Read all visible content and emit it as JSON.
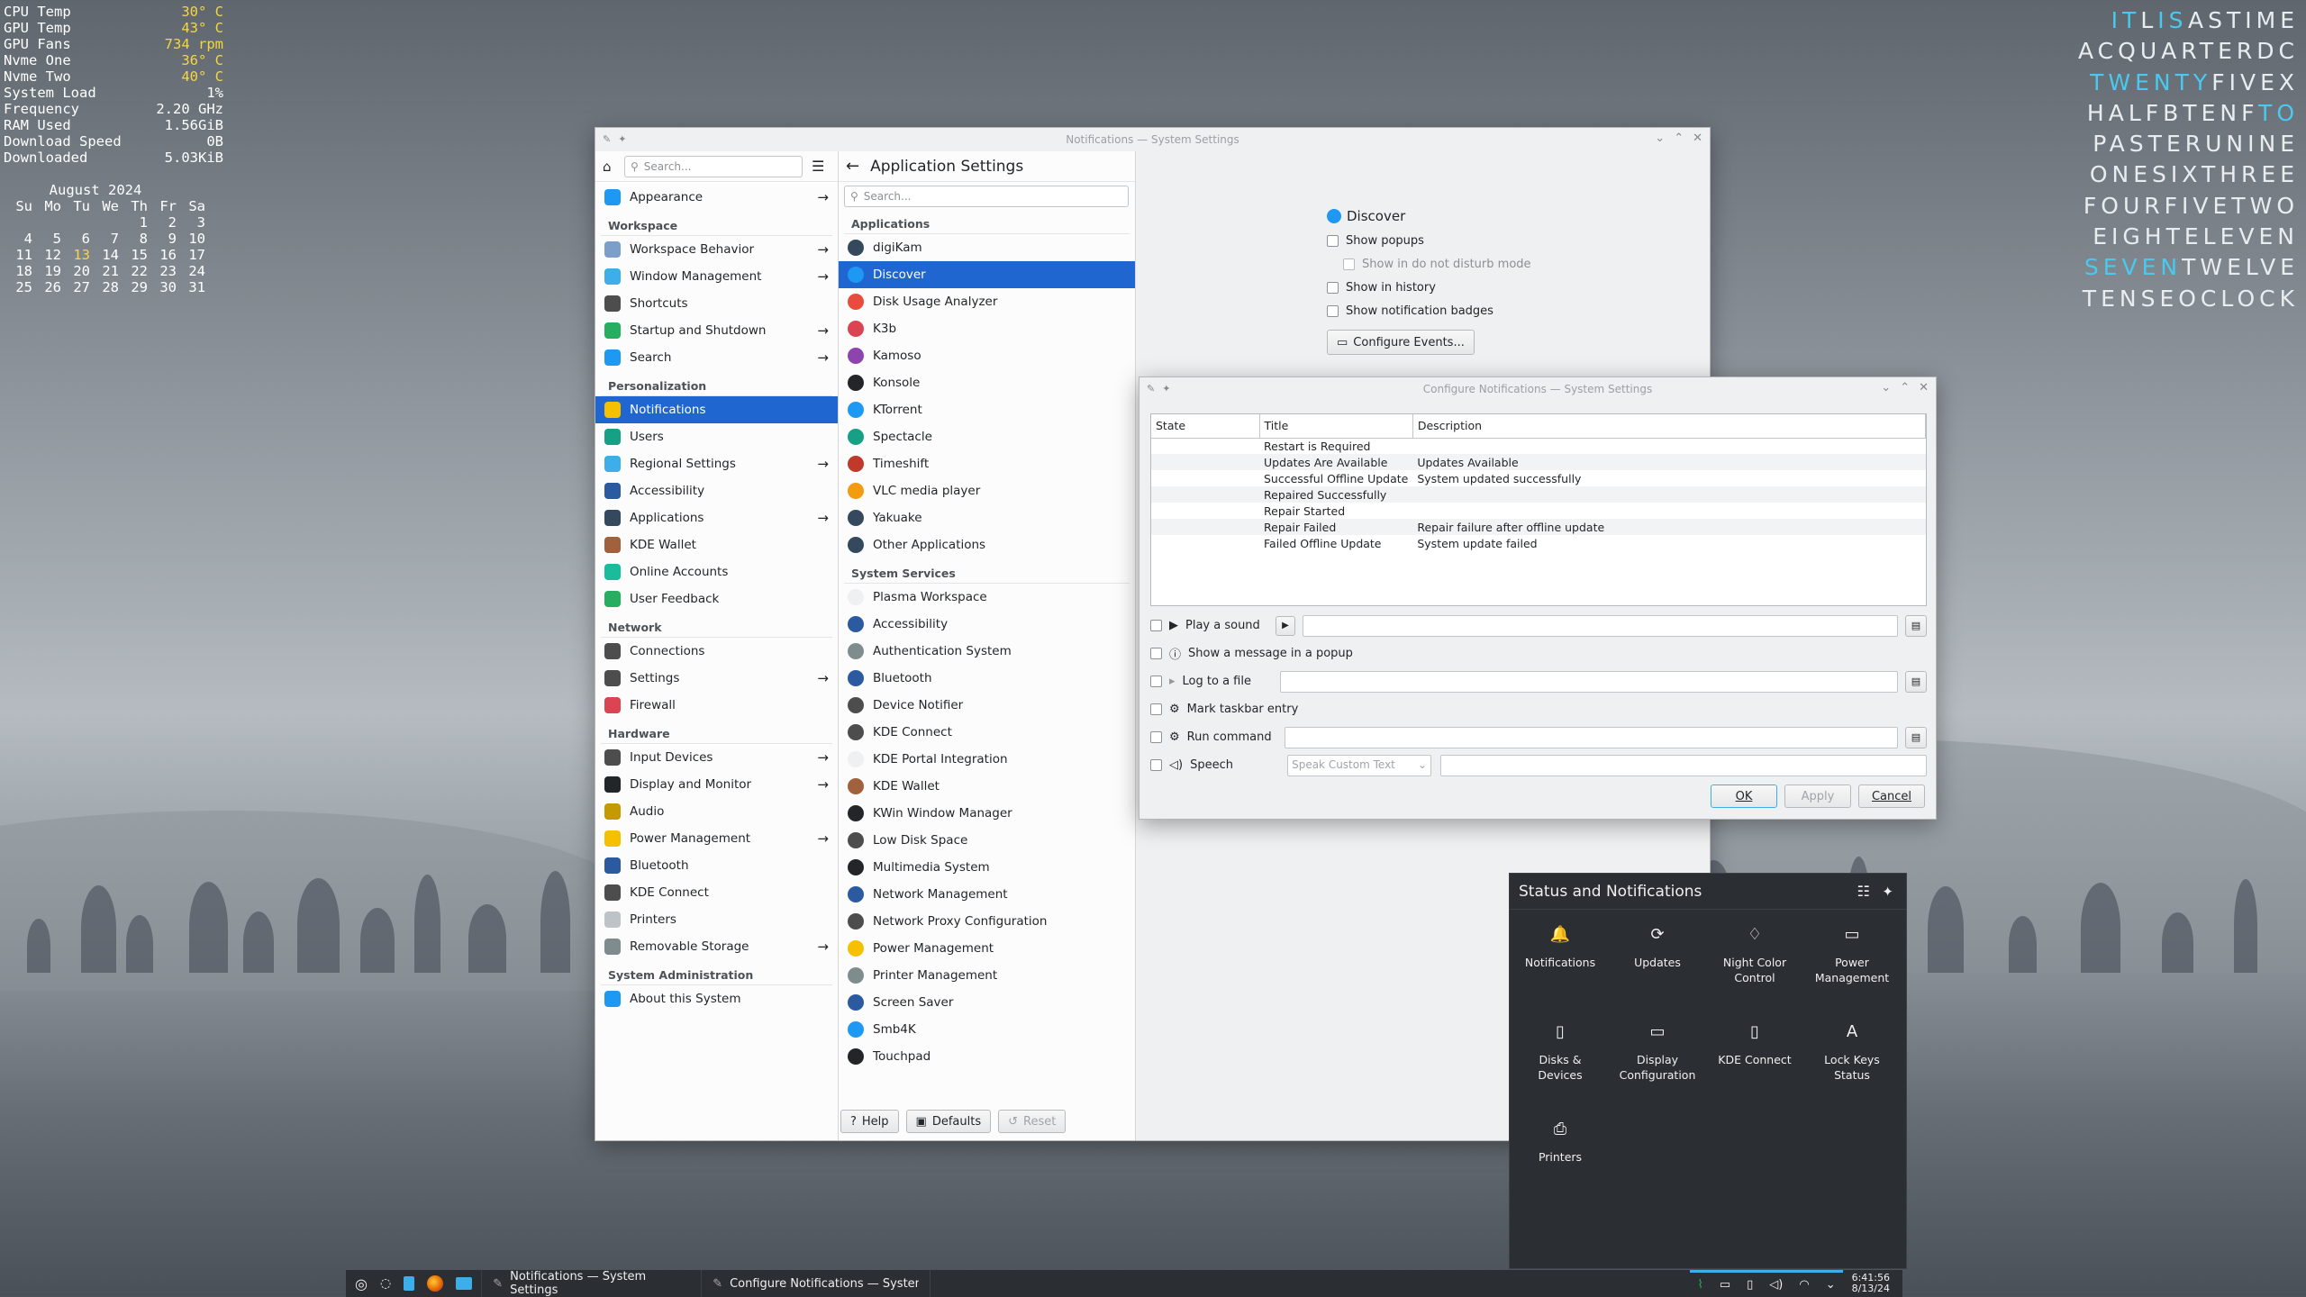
{
  "conky": {
    "rows": [
      [
        "CPU Temp",
        "30° C"
      ],
      [
        "GPU Temp",
        "43° C"
      ],
      [
        "GPU Fans",
        "734 rpm"
      ],
      [
        "Nvme One",
        "36° C"
      ],
      [
        "Nvme Two",
        "40° C"
      ],
      [
        "System Load",
        "1%"
      ],
      [
        "Frequency",
        "2.20 GHz"
      ],
      [
        "RAM Used",
        "1.56GiB"
      ],
      [
        "Download Speed",
        "0B"
      ],
      [
        "Downloaded",
        "5.03KiB"
      ]
    ],
    "calendar_title": "August 2024",
    "calendar_header": [
      "Su",
      "Mo",
      "Tu",
      "We",
      "Th",
      "Fr",
      "Sa"
    ],
    "calendar_days": [
      "",
      "",
      "",
      "",
      "1",
      "2",
      "3",
      "4",
      "5",
      "6",
      "7",
      "8",
      "9",
      "10",
      "11",
      "12",
      "13",
      "14",
      "15",
      "16",
      "17",
      "18",
      "19",
      "20",
      "21",
      "22",
      "23",
      "24",
      "25",
      "26",
      "27",
      "28",
      "29",
      "30",
      "31"
    ],
    "today": "13",
    "accent": "#f5d742"
  },
  "word_clock": {
    "lines": [
      "ITLISASTIME",
      "ACQUARTERDC",
      "TWENTYFIVEX",
      "HALFBTENFTO",
      "PASTERUNINE",
      "ONESIXTHREE",
      "FOURFIVETWO",
      "EIGHTELEVEN",
      "SEVENTWELVE",
      "TENSEOCLOCK"
    ],
    "highlight_color": "#49c9ef"
  },
  "settings": {
    "window_title": "Notifications — System Settings",
    "search_placeholder": "Search...",
    "page_title": "Application Settings",
    "sidebar": [
      {
        "type": "item",
        "label": "Appearance",
        "arrow": true,
        "color": "#1d99f3"
      },
      {
        "type": "head",
        "label": "Workspace"
      },
      {
        "type": "item",
        "label": "Workspace Behavior",
        "arrow": true,
        "color": "#7b9fc9"
      },
      {
        "type": "item",
        "label": "Window Management",
        "arrow": true,
        "color": "#3daee9"
      },
      {
        "type": "item",
        "label": "Shortcuts",
        "arrow": false,
        "color": "#4d4d4d"
      },
      {
        "type": "item",
        "label": "Startup and Shutdown",
        "arrow": true,
        "color": "#27ae60"
      },
      {
        "type": "item",
        "label": "Search",
        "arrow": true,
        "color": "#1d99f3"
      },
      {
        "type": "head",
        "label": "Personalization"
      },
      {
        "type": "item",
        "label": "Notifications",
        "arrow": false,
        "color": "#f6c000",
        "selected": true
      },
      {
        "type": "item",
        "label": "Users",
        "arrow": false,
        "color": "#16a085"
      },
      {
        "type": "item",
        "label": "Regional Settings",
        "arrow": true,
        "color": "#3daee9"
      },
      {
        "type": "item",
        "label": "Accessibility",
        "arrow": false,
        "color": "#2c5aa0"
      },
      {
        "type": "item",
        "label": "Applications",
        "arrow": true,
        "color": "#34495e"
      },
      {
        "type": "item",
        "label": "KDE Wallet",
        "arrow": false,
        "color": "#a0613c"
      },
      {
        "type": "item",
        "label": "Online Accounts",
        "arrow": false,
        "color": "#1abc9c"
      },
      {
        "type": "item",
        "label": "User Feedback",
        "arrow": false,
        "color": "#27ae60"
      },
      {
        "type": "head",
        "label": "Network"
      },
      {
        "type": "item",
        "label": "Connections",
        "arrow": false,
        "color": "#4d4d4d"
      },
      {
        "type": "item",
        "label": "Settings",
        "arrow": true,
        "color": "#4d4d4d"
      },
      {
        "type": "item",
        "label": "Firewall",
        "arrow": false,
        "color": "#da4453"
      },
      {
        "type": "head",
        "label": "Hardware"
      },
      {
        "type": "item",
        "label": "Input Devices",
        "arrow": true,
        "color": "#4d4d4d"
      },
      {
        "type": "item",
        "label": "Display and Monitor",
        "arrow": true,
        "color": "#232629"
      },
      {
        "type": "item",
        "label": "Audio",
        "arrow": false,
        "color": "#c49a00"
      },
      {
        "type": "item",
        "label": "Power Management",
        "arrow": true,
        "color": "#f6c000"
      },
      {
        "type": "item",
        "label": "Bluetooth",
        "arrow": false,
        "color": "#2c5aa0"
      },
      {
        "type": "item",
        "label": "KDE Connect",
        "arrow": false,
        "color": "#4d4d4d"
      },
      {
        "type": "item",
        "label": "Printers",
        "arrow": false,
        "color": "#bdc3c7"
      },
      {
        "type": "item",
        "label": "Removable Storage",
        "arrow": true,
        "color": "#7f8c8d"
      },
      {
        "type": "head",
        "label": "System Administration"
      },
      {
        "type": "item",
        "label": "About this System",
        "arrow": false,
        "color": "#1d99f3"
      }
    ],
    "app_list": [
      {
        "type": "head",
        "label": "Applications"
      },
      {
        "type": "item",
        "label": "digiKam",
        "color": "#34495e"
      },
      {
        "type": "item",
        "label": "Discover",
        "color": "#1d99f3",
        "selected": true
      },
      {
        "type": "item",
        "label": "Disk Usage Analyzer",
        "color": "#e74c3c"
      },
      {
        "type": "item",
        "label": "K3b",
        "color": "#da4453"
      },
      {
        "type": "item",
        "label": "Kamoso",
        "color": "#8e44ad"
      },
      {
        "type": "item",
        "label": "Konsole",
        "color": "#232629"
      },
      {
        "type": "item",
        "label": "KTorrent",
        "color": "#1d99f3"
      },
      {
        "type": "item",
        "label": "Spectacle",
        "color": "#16a085"
      },
      {
        "type": "item",
        "label": "Timeshift",
        "color": "#c0392b"
      },
      {
        "type": "item",
        "label": "VLC media player",
        "color": "#f39c12"
      },
      {
        "type": "item",
        "label": "Yakuake",
        "color": "#34495e"
      },
      {
        "type": "item",
        "label": "Other Applications",
        "color": "#34495e"
      },
      {
        "type": "head",
        "label": "System Services"
      },
      {
        "type": "item",
        "label": "Plasma Workspace",
        "color": "#eff0f1"
      },
      {
        "type": "item",
        "label": "Accessibility",
        "color": "#2c5aa0"
      },
      {
        "type": "item",
        "label": "Authentication System",
        "color": "#7f8c8d"
      },
      {
        "type": "item",
        "label": "Bluetooth",
        "color": "#2c5aa0"
      },
      {
        "type": "item",
        "label": "Device Notifier",
        "color": "#4d4d4d"
      },
      {
        "type": "item",
        "label": "KDE Connect",
        "color": "#4d4d4d"
      },
      {
        "type": "item",
        "label": "KDE Portal Integration",
        "color": "#eff0f1"
      },
      {
        "type": "item",
        "label": "KDE Wallet",
        "color": "#a0613c"
      },
      {
        "type": "item",
        "label": "KWin Window Manager",
        "color": "#232629"
      },
      {
        "type": "item",
        "label": "Low Disk Space",
        "color": "#4d4d4d"
      },
      {
        "type": "item",
        "label": "Multimedia System",
        "color": "#232629"
      },
      {
        "type": "item",
        "label": "Network Management",
        "color": "#2c5aa0"
      },
      {
        "type": "item",
        "label": "Network Proxy Configuration",
        "color": "#4d4d4d"
      },
      {
        "type": "item",
        "label": "Power Management",
        "color": "#f6c000"
      },
      {
        "type": "item",
        "label": "Printer Management",
        "color": "#7f8c8d"
      },
      {
        "type": "item",
        "label": "Screen Saver",
        "color": "#2c5aa0"
      },
      {
        "type": "item",
        "label": "Smb4K",
        "color": "#1d99f3"
      },
      {
        "type": "item",
        "label": "Touchpad",
        "color": "#232629"
      }
    ],
    "detail": {
      "app_name": "Discover",
      "options": [
        "Show popups",
        "Show in do not disturb mode",
        "Show in history",
        "Show notification badges"
      ],
      "configure_button": "Configure Events..."
    },
    "footer": {
      "help": "Help",
      "defaults": "Defaults",
      "reset": "Reset"
    }
  },
  "configure": {
    "window_title": "Configure Notifications — System Settings",
    "columns": [
      "State",
      "Title",
      "Description"
    ],
    "events": [
      {
        "title": "Restart is Required",
        "description": ""
      },
      {
        "title": "Updates Are Available",
        "description": "Updates Available"
      },
      {
        "title": "Successful Offline Update",
        "description": "System updated successfully"
      },
      {
        "title": "Repaired Successfully",
        "description": ""
      },
      {
        "title": "Repair Started",
        "description": ""
      },
      {
        "title": "Repair Failed",
        "description": "Repair failure after offline update"
      },
      {
        "title": "Failed Offline Update",
        "description": "System update failed"
      }
    ],
    "actions": {
      "play_sound": "Play a sound",
      "popup": "Show a message in a popup",
      "log": "Log to a file",
      "taskbar": "Mark taskbar entry",
      "command": "Run command",
      "speech": "Speech",
      "speech_select": "Speak Custom Text"
    },
    "buttons": {
      "ok": "OK",
      "apply": "Apply",
      "cancel": "Cancel"
    }
  },
  "tray": {
    "title": "Status and Notifications",
    "items": [
      "Notifications",
      "Updates",
      "Night Color Control",
      "Power Management",
      "Disks & Devices",
      "Display Configuration",
      "KDE Connect",
      "Lock Keys Status",
      "Printers"
    ]
  },
  "taskbar": {
    "tasks": [
      "Notifications — System Settings",
      "Configure Notifications — System..."
    ],
    "time": "6:41:56",
    "date": "8/13/24"
  }
}
